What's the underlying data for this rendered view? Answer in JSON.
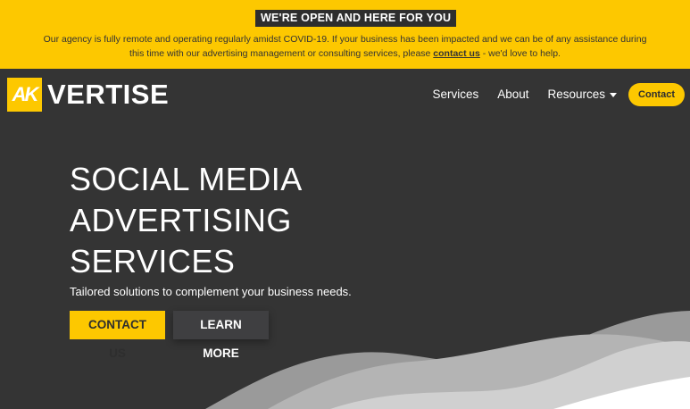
{
  "banner": {
    "badge": "WE'RE OPEN AND HERE FOR YOU",
    "text_before": "Our agency is fully remote and operating regularly amidst COVID-19. If your business has been impacted and we can be of any assistance during this time with our advertising management or consulting services, please ",
    "link": "contact us",
    "text_after": " - we'd love to help."
  },
  "logo": {
    "mark": "AK",
    "wordmark": "VERTISE"
  },
  "nav": {
    "services": "Services",
    "about": "About",
    "resources": "Resources",
    "contact": "Contact"
  },
  "hero": {
    "title_line1": "SOCIAL MEDIA",
    "title_line2": "ADVERTISING",
    "title_line3": "SERVICES",
    "subtitle": "Tailored solutions to complement your business needs.",
    "primary_button": "CONTACT US",
    "secondary_button": "LEARN MORE"
  },
  "colors": {
    "accent": "#fdc800",
    "background": "#343434",
    "dark_text": "#2e2e2e"
  }
}
